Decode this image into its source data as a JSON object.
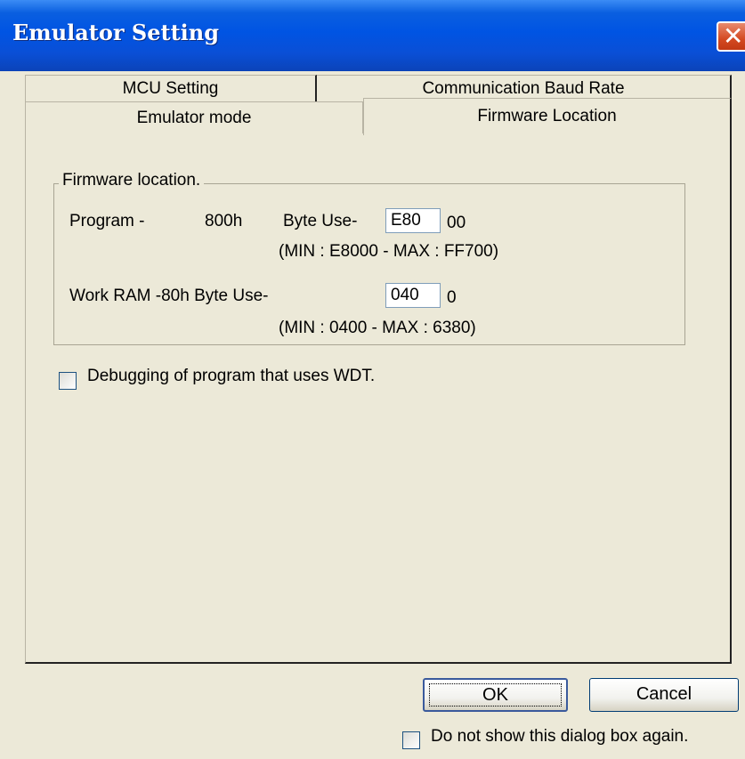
{
  "window": {
    "title": "Emulator Setting",
    "close_glyph": "✕"
  },
  "tabs": {
    "row1": [
      "MCU Setting",
      "Communication Baud Rate"
    ],
    "row2": [
      "Emulator mode",
      "Firmware Location"
    ],
    "active": "Firmware Location"
  },
  "group": {
    "legend": "Firmware location.",
    "program": {
      "label": "Program -",
      "size": "800h",
      "byte_use_label": "Byte Use-",
      "value": "E80",
      "suffix": "00",
      "range": "(MIN : E8000  -  MAX : FF700)"
    },
    "work_ram": {
      "label": "Work RAM -80h Byte Use-",
      "value": "040",
      "suffix": "0",
      "range": "(MIN : 0400  -  MAX : 6380)"
    }
  },
  "wdt_checkbox": {
    "label": "Debugging of program that uses WDT.",
    "checked": false
  },
  "buttons": {
    "ok": "OK",
    "cancel": "Cancel"
  },
  "dont_show_checkbox": {
    "label": "Do not show this dialog box again.",
    "checked": false
  }
}
